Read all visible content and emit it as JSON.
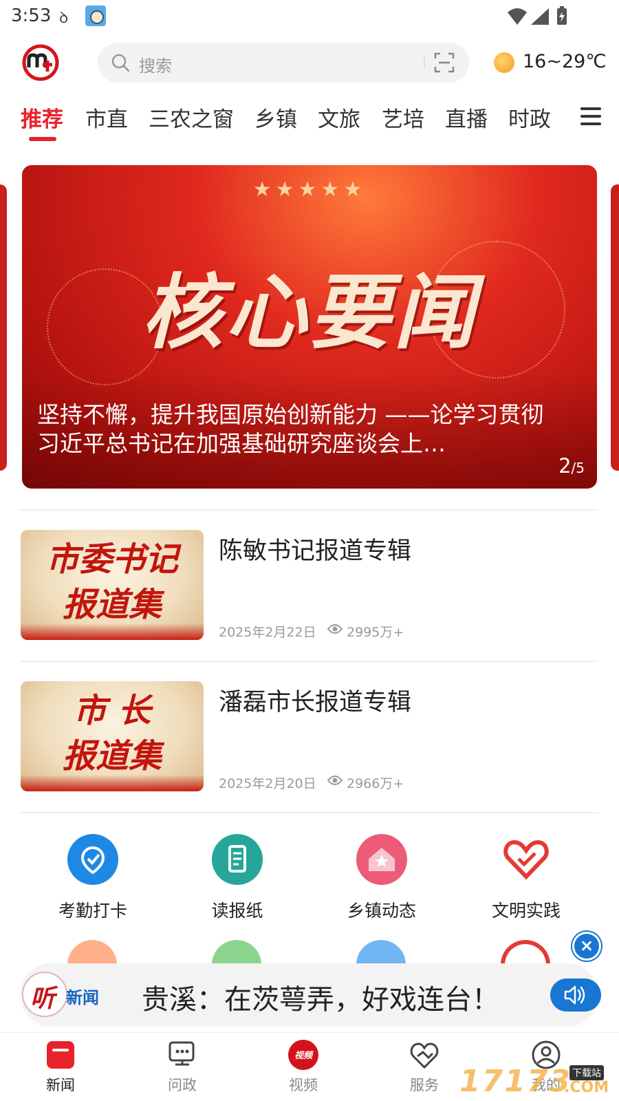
{
  "status_bar": {
    "time": "3:53",
    "glyph": "ꝺ"
  },
  "header": {
    "search_placeholder": "搜索",
    "weather": "16~29℃"
  },
  "tabs": [
    "推荐",
    "市直",
    "三农之窗",
    "乡镇",
    "文旅",
    "艺培",
    "直播",
    "时政"
  ],
  "banner": {
    "stars": "★★★★★",
    "headline": "核心要闻",
    "caption": "坚持不懈，提升我国原始创新能力 ——论学习贯彻习近平总书记在加强基础研究座谈会上…",
    "page_current": "2",
    "page_total": "/5"
  },
  "news": [
    {
      "thumb_lines": [
        "市委书记",
        "报道集"
      ],
      "title": "陈敏书记报道专辑",
      "date": "2025年2月22日",
      "views": "2995万+"
    },
    {
      "thumb_lines": [
        "市 长",
        "报道集"
      ],
      "title": "潘磊市长报道专辑",
      "date": "2025年2月20日",
      "views": "2966万+"
    }
  ],
  "services": [
    {
      "label": "考勤打卡",
      "icon": "checkin-icon",
      "color": "#1e88e5"
    },
    {
      "label": "读报纸",
      "icon": "newspaper-icon",
      "color": "#26a69a"
    },
    {
      "label": "乡镇动态",
      "icon": "town-icon",
      "color": "#ec5b78"
    },
    {
      "label": "文明实践",
      "icon": "heart-hands-icon",
      "color": "#e53935"
    }
  ],
  "audio_bar": {
    "logo_text": "新闻",
    "title": "贵溪：在茨萼弄，好戏连台！"
  },
  "bottom_nav": [
    {
      "label": "新闻",
      "icon": "news-icon",
      "active": true
    },
    {
      "label": "问政",
      "icon": "inquiry-icon",
      "active": false
    },
    {
      "label": "视频",
      "icon": "video-icon",
      "active": false,
      "badge": "视频"
    },
    {
      "label": "服务",
      "icon": "service-icon",
      "active": false
    },
    {
      "label": "我的",
      "icon": "profile-icon",
      "active": false
    }
  ],
  "watermark": {
    "text": "17173",
    "tag": "下载站",
    "suffix": ".COM"
  },
  "colors": {
    "accent": "#e8222a",
    "link_blue": "#1976d2"
  }
}
